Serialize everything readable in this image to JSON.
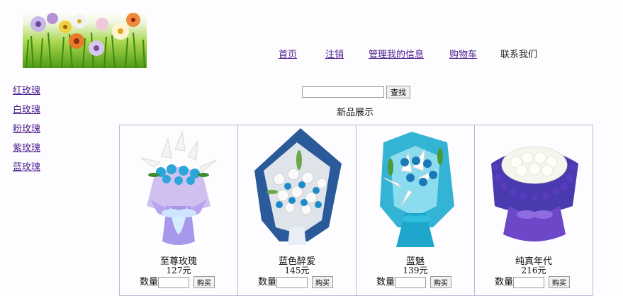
{
  "nav": {
    "home": "首页",
    "logout": "注销",
    "manage": "管理我的信息",
    "cart": "购物车",
    "contact": "联系我们"
  },
  "sidebar": {
    "items": [
      {
        "label": "红玫瑰"
      },
      {
        "label": "白玫瑰"
      },
      {
        "label": "粉玫瑰"
      },
      {
        "label": "紫玫瑰"
      },
      {
        "label": "蓝玫瑰"
      }
    ]
  },
  "search": {
    "value": "",
    "button_label": "查找"
  },
  "section_title": "新品展示",
  "products": [
    {
      "name": "至尊玫瑰",
      "price": "127元",
      "qty_label": "数量",
      "buy_label": "购买",
      "qty_value": ""
    },
    {
      "name": "蓝色醉爱",
      "price": "145元",
      "qty_label": "数量",
      "buy_label": "购买",
      "qty_value": ""
    },
    {
      "name": "蓝魅",
      "price": "139元",
      "qty_label": "数量",
      "buy_label": "购买",
      "qty_value": ""
    },
    {
      "name": "纯真年代",
      "price": "216元",
      "qty_label": "数量",
      "buy_label": "购买",
      "qty_value": ""
    }
  ],
  "colors": {
    "link": "#4a1a8c",
    "grid_border": "#b8b8d8"
  }
}
